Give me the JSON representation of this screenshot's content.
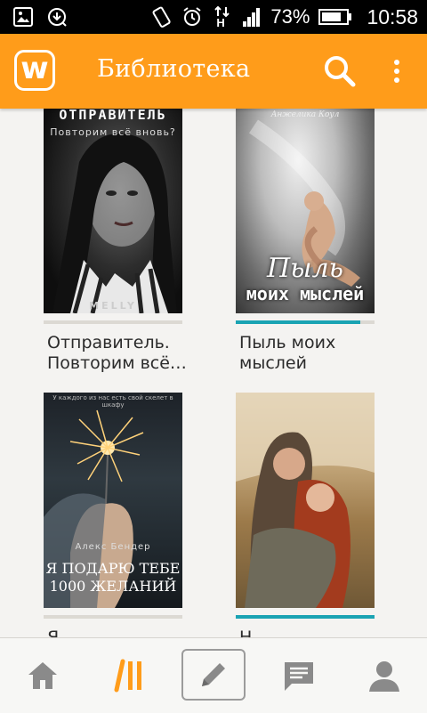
{
  "status_bar": {
    "battery_percent": "73%",
    "time": "10:58",
    "network": "H",
    "icons": [
      "image-icon",
      "download-icon",
      "rotate-icon",
      "alarm-icon",
      "network-icon",
      "signal-icon",
      "battery-icon"
    ]
  },
  "app_bar": {
    "title": "Библиотека",
    "logo_letter": "w",
    "color": "#ff9c1a"
  },
  "books": [
    {
      "title": "Отправитель. Повторим всё…",
      "progress": 0,
      "cover": {
        "heading": "ОТПРАВИТЕЛЬ",
        "subheading": "Повторим всё вновь?",
        "author": "MELLY"
      }
    },
    {
      "title": "Пыль моих мыслей",
      "progress": 0.9,
      "cover": {
        "author": "Анжелика Коул",
        "line1": "Пыль",
        "line2": "моих мыслей"
      }
    },
    {
      "title": "Я…",
      "progress": 0,
      "cover": {
        "tagline": "У каждого из нас есть свой скелет в шкафу",
        "author": "Алекс Бендер",
        "line1": "Я ПОДАРЮ ТЕБЕ",
        "line2": "1000 ЖЕЛАНИЙ"
      }
    },
    {
      "title": "Н…",
      "progress": 1.0,
      "cover": {}
    }
  ],
  "bottom_nav": {
    "items": [
      {
        "name": "home",
        "icon": "home-icon",
        "active": false
      },
      {
        "name": "library",
        "icon": "library-icon",
        "active": true
      },
      {
        "name": "write",
        "icon": "pencil-icon",
        "active": false
      },
      {
        "name": "messages",
        "icon": "messages-icon",
        "active": false
      },
      {
        "name": "profile",
        "icon": "profile-icon",
        "active": false
      }
    ],
    "active_color": "#ff9c1a",
    "inactive_color": "#8a8a8a"
  }
}
